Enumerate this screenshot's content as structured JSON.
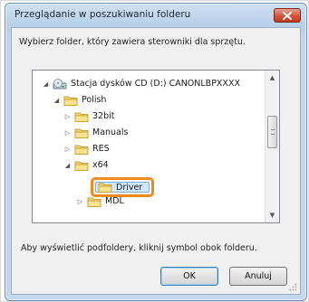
{
  "window": {
    "title": "Przeglądanie w poszukiwaniu folderu",
    "instruction": "Wybierz folder, który zawiera sterowniki dla sprzętu.",
    "hint": "Aby wyświetlić podfoldery, kliknij symbol obok folderu."
  },
  "tree": {
    "nodes": [
      {
        "label": "Stacja dysków CD (D:) CANONLBPXXXX",
        "icon": "cd-drive-icon",
        "state": "expanded"
      },
      {
        "label": "Polish",
        "icon": "folder-icon",
        "state": "expanded"
      },
      {
        "label": "32bit",
        "icon": "folder-icon",
        "state": "collapsed"
      },
      {
        "label": "Manuals",
        "icon": "folder-icon",
        "state": "collapsed"
      },
      {
        "label": "RES",
        "icon": "folder-icon",
        "state": "collapsed"
      },
      {
        "label": "x64",
        "icon": "folder-icon",
        "state": "expanded"
      },
      {
        "label": "Driver",
        "icon": "folder-icon",
        "state": "selected"
      },
      {
        "label": "MDL",
        "icon": "folder-icon",
        "state": "collapsed"
      }
    ]
  },
  "buttons": {
    "ok": "OK",
    "cancel": "Anuluj"
  },
  "colors": {
    "highlight": "#f08a1a",
    "selection": "#cde8ff",
    "close_button": "#c13b22"
  }
}
